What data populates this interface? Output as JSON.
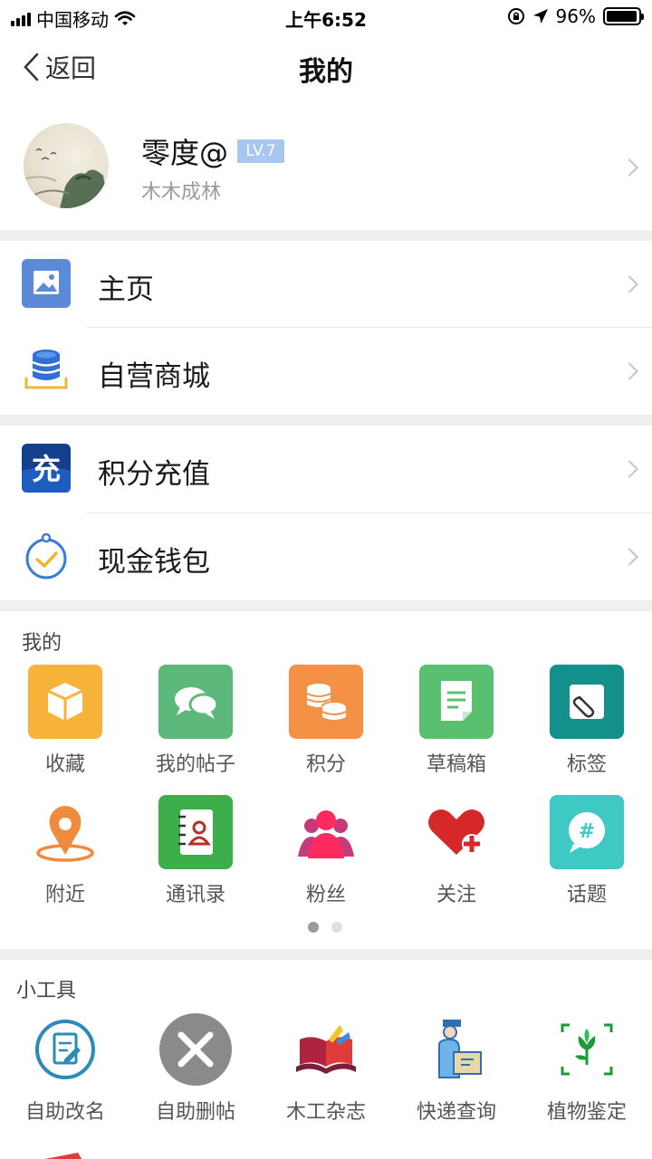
{
  "status_bar": {
    "carrier": "中国移动",
    "time": "上午6:52",
    "battery": "96%",
    "battery_level": 0.96
  },
  "nav": {
    "back_label": "返回",
    "title": "我的"
  },
  "profile": {
    "name": "零度@",
    "level": "LV.7",
    "subtitle": "木木成林"
  },
  "menu_group_1": [
    {
      "label": "主页",
      "icon": "image-icon"
    },
    {
      "label": "自营商城",
      "icon": "database-icon"
    }
  ],
  "menu_group_2": [
    {
      "label": "积分充值",
      "icon": "recharge-icon",
      "icon_text": "充"
    },
    {
      "label": "现金钱包",
      "icon": "wallet-check-icon"
    }
  ],
  "mine_section": {
    "title": "我的",
    "items": [
      {
        "label": "收藏",
        "icon": "box-icon",
        "color": "#f7b23b"
      },
      {
        "label": "我的帖子",
        "icon": "chat-bubbles-icon",
        "color": "#5cb97b"
      },
      {
        "label": "积分",
        "icon": "coins-icon",
        "color": "#f59144"
      },
      {
        "label": "草稿箱",
        "icon": "draft-icon",
        "color": "#58c06e"
      },
      {
        "label": "标签",
        "icon": "paperclip-icon",
        "color": "#13908c"
      },
      {
        "label": "附近",
        "icon": "location-pin-icon",
        "color": "#f08a3c"
      },
      {
        "label": "通讯录",
        "icon": "contacts-book-icon",
        "color": "#3cae4a"
      },
      {
        "label": "粉丝",
        "icon": "fans-icon",
        "color": "#e8336f"
      },
      {
        "label": "关注",
        "icon": "heart-plus-icon",
        "color": "#d62828"
      },
      {
        "label": "话题",
        "icon": "topic-hash-icon",
        "color": "#3ec9c4"
      }
    ],
    "page_count": 2,
    "active_page": 1
  },
  "tools_section": {
    "title": "小工具",
    "items": [
      {
        "label": "自助改名",
        "icon": "edit-doc-icon"
      },
      {
        "label": "自助删帖",
        "icon": "delete-x-icon"
      },
      {
        "label": "木工杂志",
        "icon": "open-book-icon"
      },
      {
        "label": "快递查询",
        "icon": "courier-icon"
      },
      {
        "label": "植物鉴定",
        "icon": "plant-scan-icon"
      }
    ]
  }
}
